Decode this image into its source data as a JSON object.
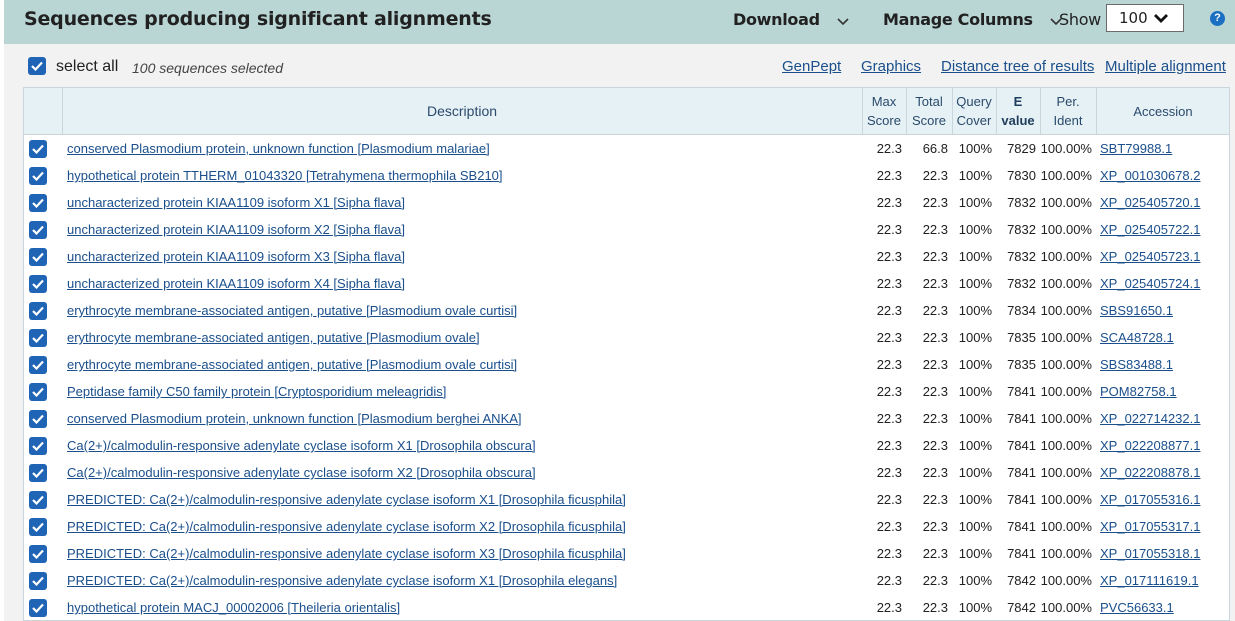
{
  "header": {
    "title": "Sequences producing significant alignments",
    "download_label": "Download",
    "manage_columns_label": "Manage Columns",
    "show_label": "Show",
    "show_value": "100",
    "help_label": "?"
  },
  "toolbar": {
    "select_all_label": "select all",
    "selected_count": "100 sequences selected",
    "links": [
      "GenPept",
      "Graphics",
      "Distance tree of results",
      "Multiple alignment"
    ]
  },
  "table": {
    "columns": {
      "description": "Description",
      "max_score": [
        "Max",
        "Score"
      ],
      "total_score": [
        "Total",
        "Score"
      ],
      "query_cover": [
        "Query",
        "Cover"
      ],
      "e_value": [
        "E",
        "value"
      ],
      "per_ident": [
        "Per.",
        "Ident"
      ],
      "accession": "Accession"
    },
    "rows": [
      {
        "description": "conserved Plasmodium protein, unknown function [Plasmodium malariae]",
        "max": "22.3",
        "total": "66.8",
        "cover": "100%",
        "evalue": "7829",
        "ident": "100.00%",
        "accession": "SBT79988.1"
      },
      {
        "description": "hypothetical protein TTHERM_01043320 [Tetrahymena thermophila SB210]",
        "max": "22.3",
        "total": "22.3",
        "cover": "100%",
        "evalue": "7830",
        "ident": "100.00%",
        "accession": "XP_001030678.2"
      },
      {
        "description": "uncharacterized protein KIAA1109 isoform X1 [Sipha flava]",
        "max": "22.3",
        "total": "22.3",
        "cover": "100%",
        "evalue": "7832",
        "ident": "100.00%",
        "accession": "XP_025405720.1"
      },
      {
        "description": "uncharacterized protein KIAA1109 isoform X2 [Sipha flava]",
        "max": "22.3",
        "total": "22.3",
        "cover": "100%",
        "evalue": "7832",
        "ident": "100.00%",
        "accession": "XP_025405722.1"
      },
      {
        "description": "uncharacterized protein KIAA1109 isoform X3 [Sipha flava]",
        "max": "22.3",
        "total": "22.3",
        "cover": "100%",
        "evalue": "7832",
        "ident": "100.00%",
        "accession": "XP_025405723.1"
      },
      {
        "description": "uncharacterized protein KIAA1109 isoform X4 [Sipha flava]",
        "max": "22.3",
        "total": "22.3",
        "cover": "100%",
        "evalue": "7832",
        "ident": "100.00%",
        "accession": "XP_025405724.1"
      },
      {
        "description": "erythrocyte membrane-associated antigen, putative [Plasmodium ovale curtisi]",
        "max": "22.3",
        "total": "22.3",
        "cover": "100%",
        "evalue": "7834",
        "ident": "100.00%",
        "accession": "SBS91650.1"
      },
      {
        "description": "erythrocyte membrane-associated antigen, putative [Plasmodium ovale]",
        "max": "22.3",
        "total": "22.3",
        "cover": "100%",
        "evalue": "7835",
        "ident": "100.00%",
        "accession": "SCA48728.1"
      },
      {
        "description": "erythrocyte membrane-associated antigen, putative [Plasmodium ovale curtisi]",
        "max": "22.3",
        "total": "22.3",
        "cover": "100%",
        "evalue": "7835",
        "ident": "100.00%",
        "accession": "SBS83488.1"
      },
      {
        "description": "Peptidase family C50 family protein [Cryptosporidium meleagridis]",
        "max": "22.3",
        "total": "22.3",
        "cover": "100%",
        "evalue": "7841",
        "ident": "100.00%",
        "accession": "POM82758.1"
      },
      {
        "description": "conserved Plasmodium protein, unknown function [Plasmodium berghei ANKA]",
        "max": "22.3",
        "total": "22.3",
        "cover": "100%",
        "evalue": "7841",
        "ident": "100.00%",
        "accession": "XP_022714232.1"
      },
      {
        "description": "Ca(2+)/calmodulin-responsive adenylate cyclase isoform X1 [Drosophila obscura]",
        "max": "22.3",
        "total": "22.3",
        "cover": "100%",
        "evalue": "7841",
        "ident": "100.00%",
        "accession": "XP_022208877.1"
      },
      {
        "description": "Ca(2+)/calmodulin-responsive adenylate cyclase isoform X2 [Drosophila obscura]",
        "max": "22.3",
        "total": "22.3",
        "cover": "100%",
        "evalue": "7841",
        "ident": "100.00%",
        "accession": "XP_022208878.1"
      },
      {
        "description": "PREDICTED: Ca(2+)/calmodulin-responsive adenylate cyclase isoform X1 [Drosophila ficusphila]",
        "max": "22.3",
        "total": "22.3",
        "cover": "100%",
        "evalue": "7841",
        "ident": "100.00%",
        "accession": "XP_017055316.1"
      },
      {
        "description": "PREDICTED: Ca(2+)/calmodulin-responsive adenylate cyclase isoform X2 [Drosophila ficusphila]",
        "max": "22.3",
        "total": "22.3",
        "cover": "100%",
        "evalue": "7841",
        "ident": "100.00%",
        "accession": "XP_017055317.1"
      },
      {
        "description": "PREDICTED: Ca(2+)/calmodulin-responsive adenylate cyclase isoform X3 [Drosophila ficusphila]",
        "max": "22.3",
        "total": "22.3",
        "cover": "100%",
        "evalue": "7841",
        "ident": "100.00%",
        "accession": "XP_017055318.1"
      },
      {
        "description": "PREDICTED: Ca(2+)/calmodulin-responsive adenylate cyclase isoform X1 [Drosophila elegans]",
        "max": "22.3",
        "total": "22.3",
        "cover": "100%",
        "evalue": "7842",
        "ident": "100.00%",
        "accession": "XP_017111619.1"
      },
      {
        "description": "hypothetical protein MACJ_00002006 [Theileria orientalis]",
        "max": "22.3",
        "total": "22.3",
        "cover": "100%",
        "evalue": "7842",
        "ident": "100.00%",
        "accession": "PVC56633.1"
      }
    ]
  },
  "icons": {
    "checkbox": "checkbox-checked-icon",
    "chevron": "chevron-down-icon",
    "help": "help-icon"
  },
  "colors": {
    "header_bg": "#b9d6d5",
    "checkbox": "#1f64b5",
    "link": "#1a4f8c",
    "column_header_bg": "#e6f1f6"
  }
}
